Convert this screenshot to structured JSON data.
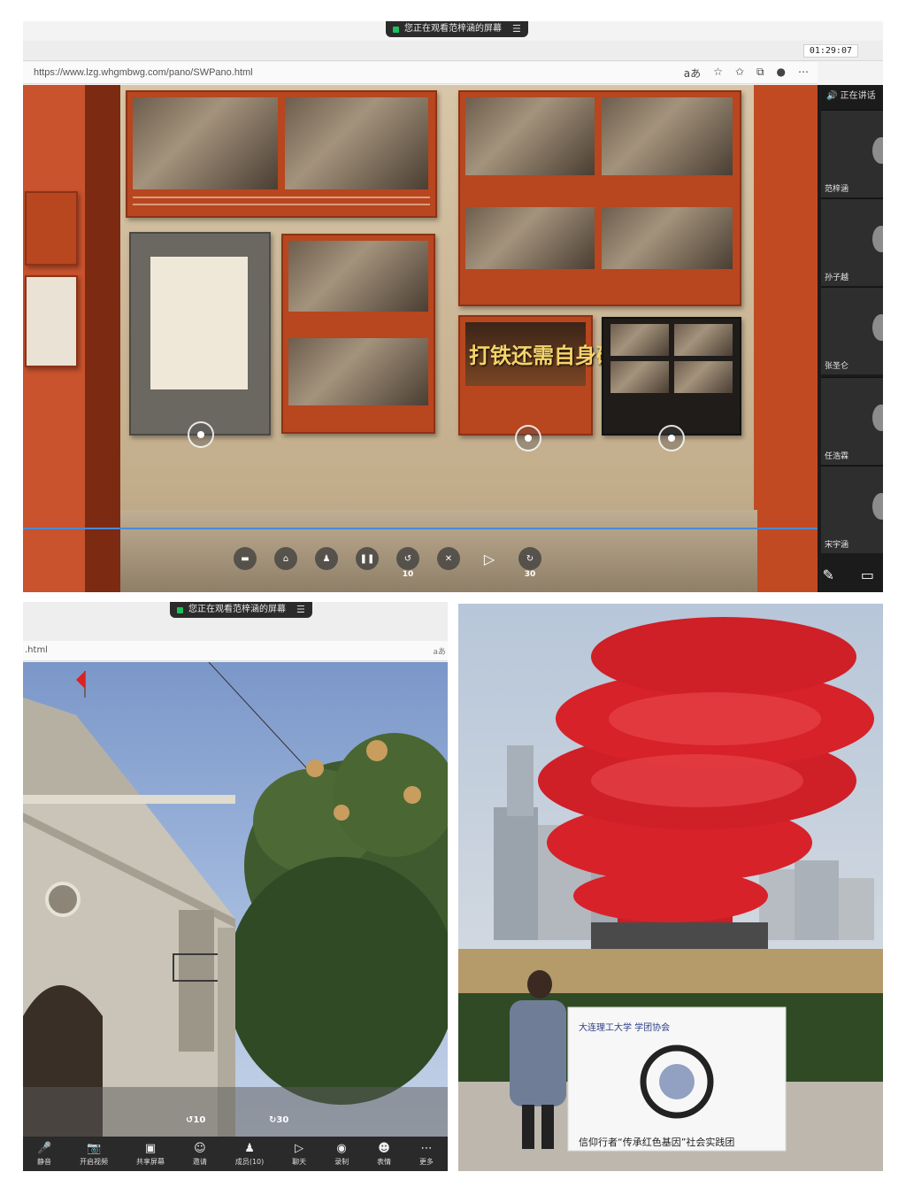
{
  "top": {
    "share_banner": "您正在观看范梓涵的屏幕",
    "timer": "01:29:07",
    "url": "https://www.lzg.whgmbwg.com/pano/SWPano.html",
    "address_icons": [
      "read-aloud-icon",
      "favorite-add-icon",
      "favorites-icon",
      "collections-icon",
      "profile-icon",
      "more-icon"
    ],
    "exhibit_big_title": "打铁还需自身硬",
    "player": {
      "rewind_label": "10",
      "forward_label": "30"
    },
    "participants": {
      "header": "正在讲话",
      "names": [
        "范梓涵",
        "孙子越",
        "张圣仑",
        "任浩霖",
        "宋宇涵"
      ]
    }
  },
  "bottom_left": {
    "share_banner": "您正在观看范梓涵的屏幕",
    "url": ".html",
    "toolbar": [
      {
        "label": "静音",
        "icon": "mic-icon"
      },
      {
        "label": "开启视频",
        "icon": "camera-off-icon"
      },
      {
        "label": "共享屏幕",
        "icon": "share-screen-icon"
      },
      {
        "label": "邀请",
        "icon": "invite-icon"
      },
      {
        "label": "成员(10)",
        "icon": "members-icon"
      },
      {
        "label": "聊天",
        "icon": "chat-icon"
      },
      {
        "label": "录制",
        "icon": "record-icon"
      },
      {
        "label": "表情",
        "icon": "emoji-icon"
      },
      {
        "label": "更多",
        "icon": "more-icon"
      }
    ],
    "overlay": {
      "rewind_label": "10",
      "forward_label": "30"
    }
  },
  "bottom_right": {
    "banner_header": "大连理工大学 学团协会",
    "banner_text": "信仰行者“传承红色基因”社会实践团"
  },
  "colors": {
    "exhibit_red": "#b8461f",
    "sculpture_red": "#d7222a",
    "meeting_dark": "#1b1b1b",
    "share_green": "#1fbf5b"
  }
}
